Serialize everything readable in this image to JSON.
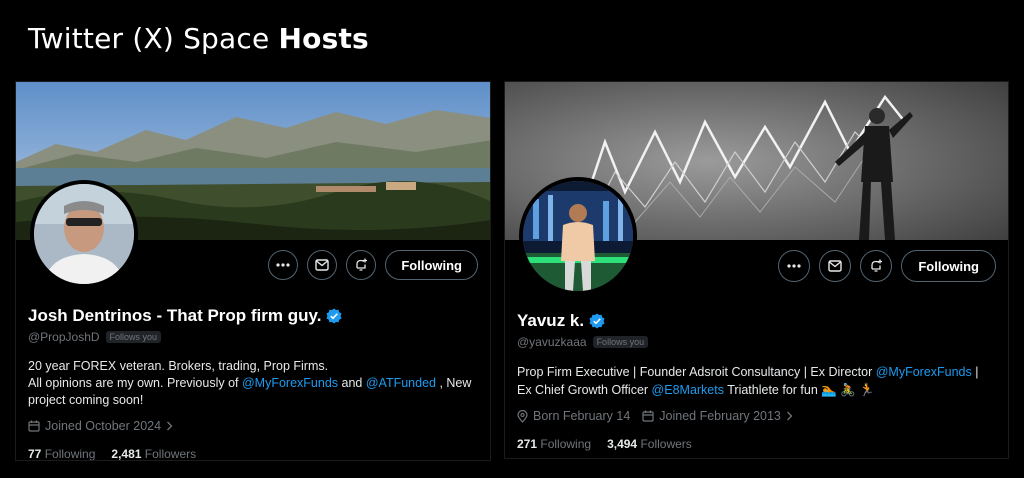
{
  "heading": {
    "prefix": "Twitter (X) Space ",
    "bold": "Hosts"
  },
  "profiles": [
    {
      "name": "Josh Dentrinos - That Prop firm guy.",
      "handle": "@PropJoshD",
      "follows_you": "Follows you",
      "bio_line1": "20 year FOREX veteran. Brokers, trading, Prop Firms.",
      "bio_line2_a": "All opinions are my own. Previously of ",
      "bio_link1": "@MyForexFunds",
      "bio_line2_b": " and ",
      "bio_link2": "@ATFunded",
      "bio_line2_c": " , New",
      "bio_line3": "project coming soon!",
      "joined": "Joined October 2024",
      "following_count": "77",
      "following_label": "Following",
      "followers_count": "2,481",
      "followers_label": "Followers",
      "follow_button": "Following"
    },
    {
      "name": "Yavuz k.",
      "handle": "@yavuzkaaa",
      "follows_you": "Follows you",
      "bio_a": "Prop Firm Executive | Founder Adsroit Consultancy | Ex Director ",
      "bio_link1": "@MyForexFunds",
      "bio_b": " |",
      "bio_c": "Ex Chief Growth Officer ",
      "bio_link2": "@E8Markets",
      "bio_d": " Triathlete for fun ",
      "bio_emoji": "🏊 🚴 🏃",
      "born": "Born February 14",
      "joined": "Joined February 2013",
      "following_count": "271",
      "following_label": "Following",
      "followers_count": "3,494",
      "followers_label": "Followers",
      "follow_button": "Following"
    }
  ],
  "colors": {
    "accent": "#1d9bf0",
    "muted": "#71767b",
    "border": "#536471"
  }
}
